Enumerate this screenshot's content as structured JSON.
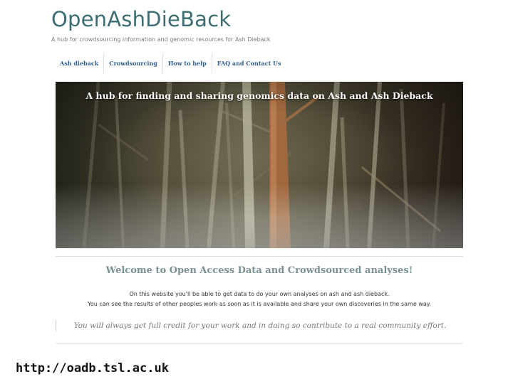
{
  "site": {
    "title": "OpenAshDieBack",
    "tagline": "A hub for crowdsourcing information and genomic resources for Ash Dieback"
  },
  "nav": {
    "items": [
      {
        "label": "Ash dieback"
      },
      {
        "label": "Crowdsourcing"
      },
      {
        "label": "How to help"
      },
      {
        "label": "FAQ and Contact Us"
      }
    ]
  },
  "hero": {
    "caption": "A hub for finding and sharing genomics data on Ash and Ash Dieback"
  },
  "content": {
    "welcome": "Welcome to Open Access Data and Crowdsourced analyses!",
    "line1": "On this website you'll be able to get data to do your own analyses on ash and ash dieback.",
    "line2": "You can see the results of other peoples work as soon as it is available and share your own discoveries in the same way.",
    "quote": "You will always get full credit for your work and in doing so contribute to a real community effort."
  },
  "footer": {
    "url": "http://oadb.tsl.ac.uk"
  },
  "colors": {
    "title": "#3b6d72",
    "nav_link": "#2f5f8f",
    "welcome": "#7b9095"
  }
}
